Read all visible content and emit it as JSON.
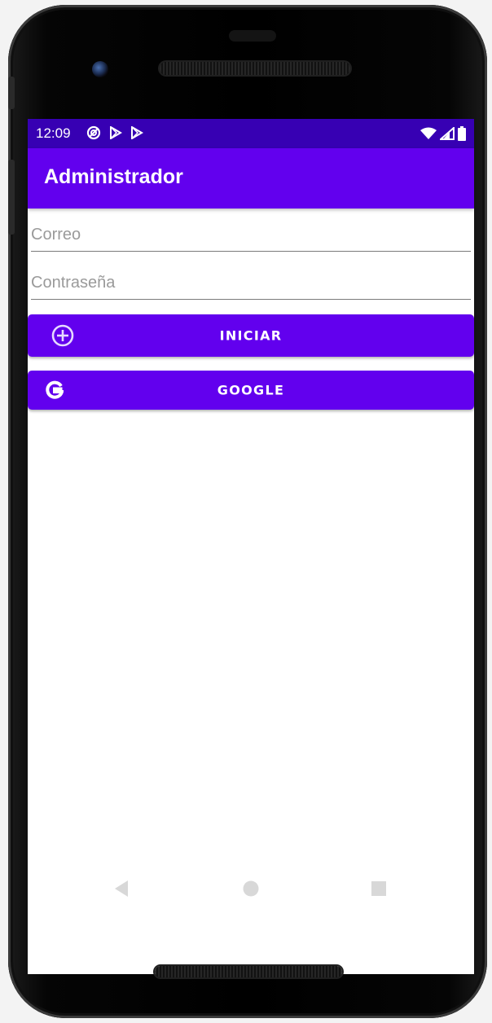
{
  "status_bar": {
    "time": "12:09",
    "left_icons": [
      "sync-icon",
      "play-store-icon",
      "play-store-icon"
    ],
    "right_icons": [
      "wifi-icon",
      "cell-signal-icon",
      "battery-icon"
    ],
    "color": "#3700b3"
  },
  "app_bar": {
    "title": "Administrador",
    "color": "#6200ee"
  },
  "form": {
    "email_placeholder": "Correo",
    "email_value": "",
    "password_placeholder": "Contraseña",
    "password_value": ""
  },
  "buttons": {
    "login_label": "INICIAR",
    "login_icon": "add-circle-icon",
    "google_label": "GOOGLE",
    "google_icon": "google-icon"
  },
  "nav_bar": {
    "items": [
      "back-icon",
      "home-icon",
      "recents-icon"
    ]
  }
}
